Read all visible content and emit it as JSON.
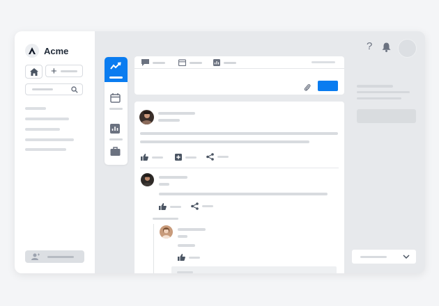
{
  "app": {
    "name": "Acme"
  },
  "colors": {
    "accent": "#0a7cf0",
    "placeholder": "#d8dbdf",
    "frame": "#e7e9ec"
  },
  "icons": {
    "home": "home-icon",
    "plus": "plus-icon",
    "search": "search-icon",
    "user": "user-icon",
    "activity": "activity-icon",
    "calendar": "calendar-icon",
    "chart": "chart-icon",
    "briefcase": "briefcase-icon",
    "help": "help-icon",
    "bell": "bell-icon",
    "chat": "chat-icon",
    "attach": "paperclip-icon",
    "like": "thumbs-up-icon",
    "add": "add-square-icon",
    "share": "share-icon",
    "chevron": "chevron-down-icon"
  },
  "header": {
    "help_label": "?"
  },
  "sidebar": {
    "new_label": "+"
  }
}
